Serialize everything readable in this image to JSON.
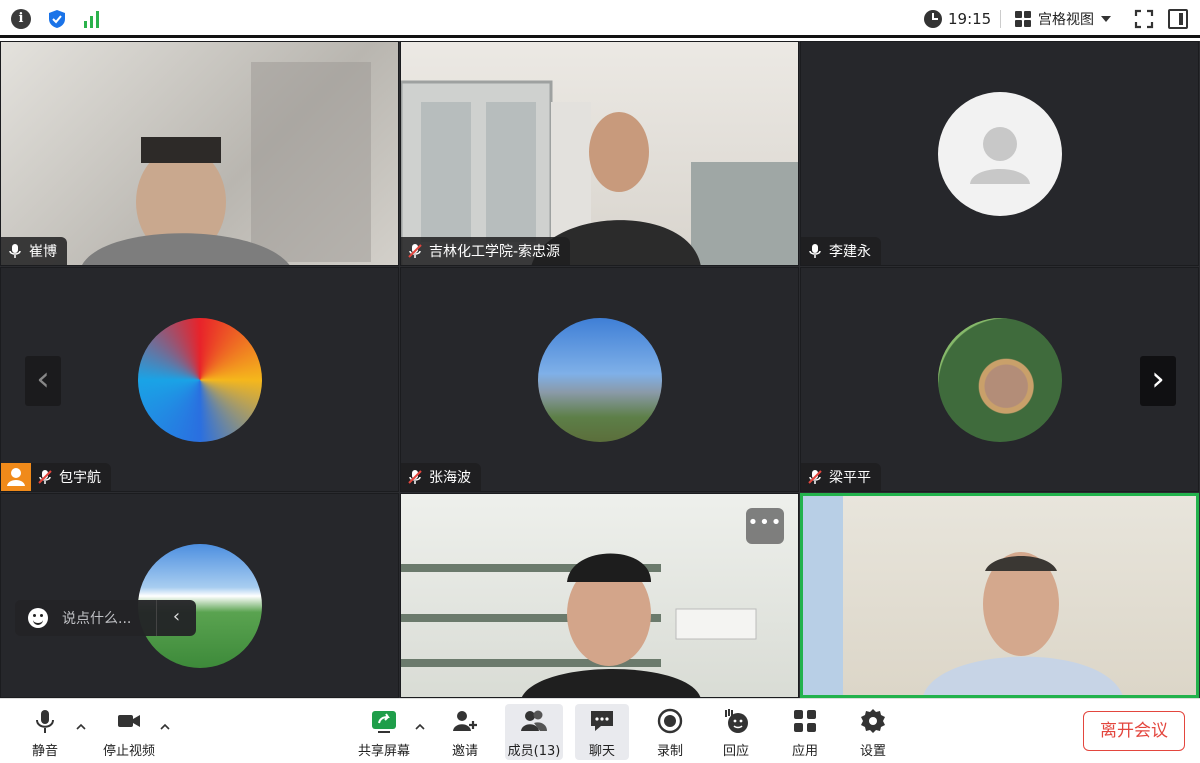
{
  "topbar": {
    "time": "19:15",
    "view_label": "宫格视图"
  },
  "participants": [
    {
      "name": "崔博",
      "mic": "on",
      "kind": "video"
    },
    {
      "name": "吉林化工学院-索忠源",
      "mic": "muted",
      "kind": "video"
    },
    {
      "name": "李建永",
      "mic": "on",
      "kind": "placeholder-avatar"
    },
    {
      "name": "包宇航",
      "mic": "muted",
      "kind": "avatar",
      "host": true
    },
    {
      "name": "张海波",
      "mic": "muted",
      "kind": "avatar"
    },
    {
      "name": "梁平平",
      "mic": "muted",
      "kind": "avatar"
    }
  ],
  "chat": {
    "placeholder": "说点什么..."
  },
  "toolbar": {
    "mute_label": "静音",
    "stop_video_label": "停止视频",
    "share_label": "共享屏幕",
    "invite_label": "邀请",
    "members_label": "成员(13)",
    "chat_label": "聊天",
    "record_label": "录制",
    "react_label": "回应",
    "apps_label": "应用",
    "settings_label": "设置",
    "leave_label": "离开会议"
  },
  "colors": {
    "speaking_border": "#22b24c",
    "leave_red": "#e3463e",
    "host_badge": "#f08a1a",
    "grid_bg": "#2b2c30"
  },
  "icons": [
    "info-icon",
    "shield-icon",
    "signal-icon",
    "clock-icon",
    "grid-view-icon",
    "fullscreen-icon",
    "sidebar-icon",
    "mic-icon",
    "mic-muted-icon",
    "camera-icon",
    "share-screen-icon",
    "add-user-icon",
    "members-icon",
    "chat-icon",
    "record-icon",
    "reaction-icon",
    "apps-icon",
    "settings-icon",
    "emoji-icon",
    "more-icon",
    "chevron-left-icon",
    "chevron-right-icon"
  ]
}
